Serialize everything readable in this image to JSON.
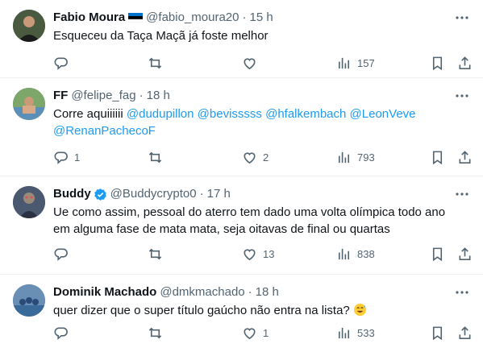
{
  "tweets": [
    {
      "name": "Fabio Moura",
      "handle": "@fabio_moura20",
      "time": "15 h",
      "text": "Esqueceu da Taça Maçã já foste melhor",
      "replies": "",
      "retweets": "",
      "likes": "",
      "views": "157",
      "flag": "estonia-flag-icon",
      "avatar_color": "#2e3a2a"
    },
    {
      "name": "FF",
      "handle": "@felipe_fag",
      "time": "18 h",
      "text_prefix": "Corre aquiiiiii",
      "mentions": [
        "@dudupillon",
        "@bevisssss",
        "@hfalkembach",
        "@LeonVeve",
        "@RenanPachecoF"
      ],
      "replies": "1",
      "retweets": "",
      "likes": "2",
      "views": "793",
      "avatar_color": "#6a8a5a"
    },
    {
      "name": "Buddy",
      "handle": "@Buddycrypto0",
      "time": "17 h",
      "text_line1": "Ue como assim, pessoal do aterro tem dado uma volta olímpica todo ano",
      "text_line2": "em alguma fase de mata mata, seja oitavas de final ou quartas",
      "replies": "",
      "retweets": "",
      "likes": "13",
      "views": "838",
      "verified": "verified-badge-icon",
      "avatar_color": "#3a4a66"
    },
    {
      "name": "Dominik Machado",
      "handle": "@dmkmachado",
      "time": "18 h",
      "text": "quer dizer que o super título gaúcho não entra na lista?",
      "emoji": "sweat-smile-emoji-icon",
      "replies": "",
      "retweets": "",
      "likes": "1",
      "views": "533",
      "avatar_color": "#3b6fa8"
    }
  ],
  "separator": "·",
  "more_icon": "more-options-icon",
  "colors": {
    "text": "#0f1419",
    "secondary": "#536471",
    "link": "#1d9bf0",
    "verified": "#1d9bf0",
    "border": "#eff3f4"
  }
}
